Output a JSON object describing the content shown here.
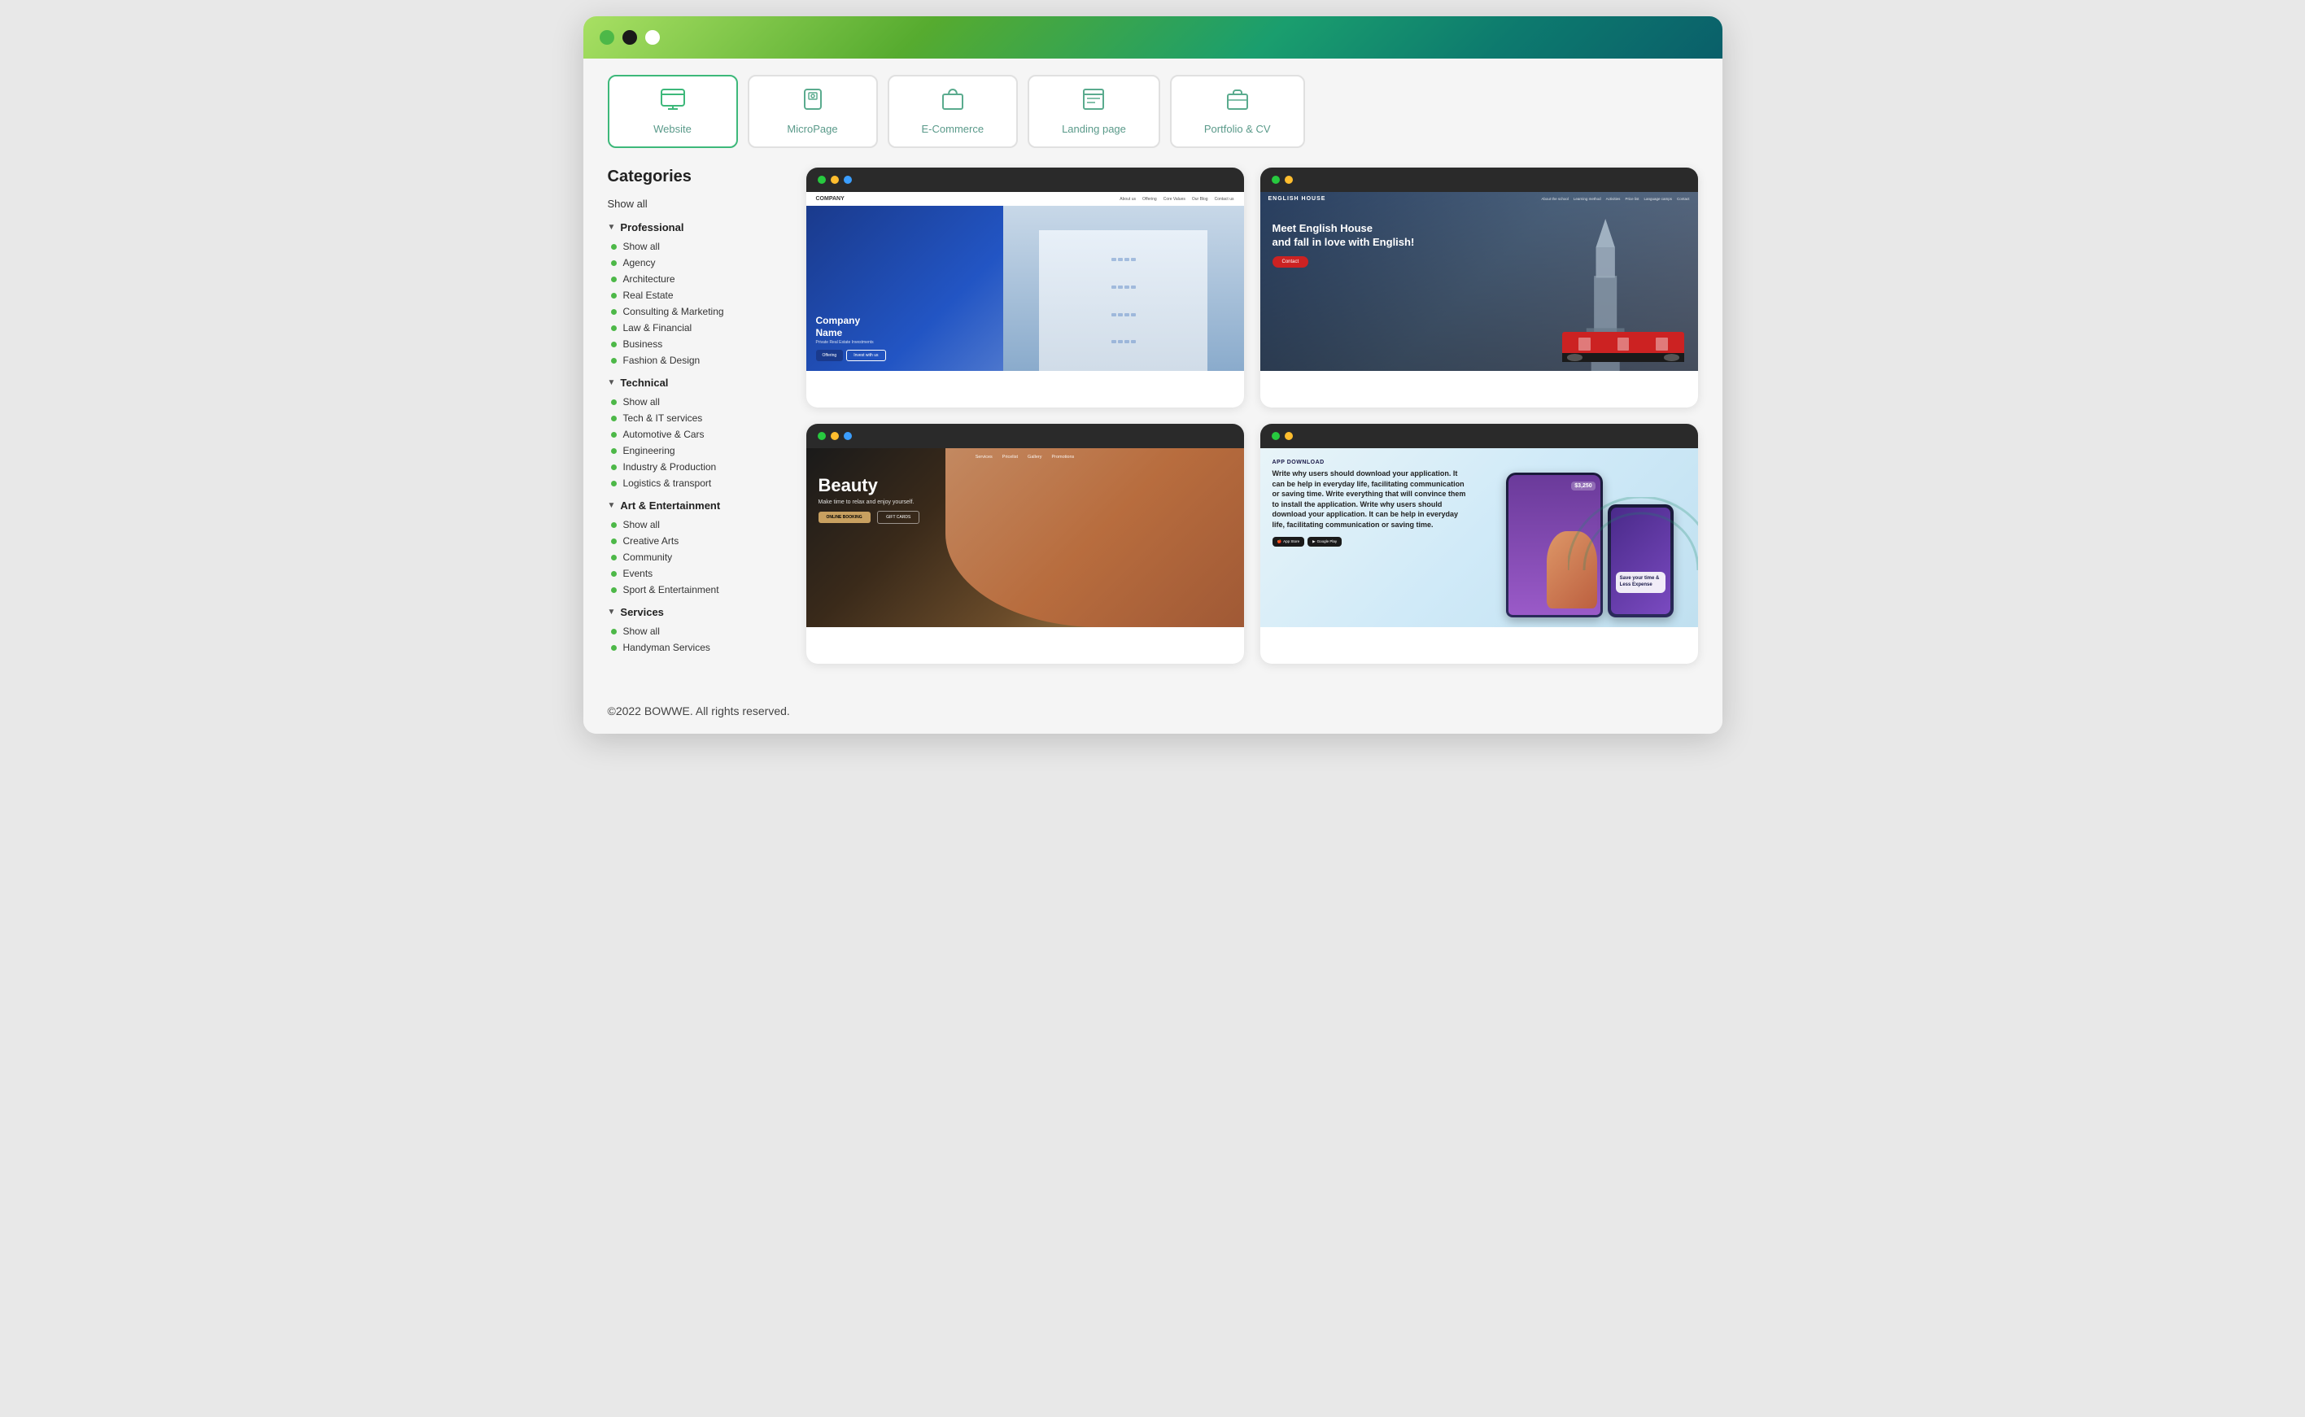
{
  "window": {
    "dots": [
      "green",
      "black",
      "white"
    ]
  },
  "tabs": [
    {
      "id": "website",
      "label": "Website",
      "icon": "🖥",
      "active": true
    },
    {
      "id": "micropage",
      "label": "MicroPage",
      "icon": "📱",
      "active": false
    },
    {
      "id": "ecommerce",
      "label": "E-Commerce",
      "icon": "🛒",
      "active": false
    },
    {
      "id": "landing",
      "label": "Landing page",
      "icon": "📄",
      "active": false
    },
    {
      "id": "portfolio",
      "label": "Portfolio & CV",
      "icon": "💼",
      "active": false
    }
  ],
  "sidebar": {
    "title": "Categories",
    "show_all": "Show all",
    "sections": [
      {
        "id": "professional",
        "label": "Professional",
        "expanded": true,
        "items": [
          {
            "label": "Show all"
          },
          {
            "label": "Agency"
          },
          {
            "label": "Architecture"
          },
          {
            "label": "Real Estate"
          },
          {
            "label": "Consulting & Marketing"
          },
          {
            "label": "Law & Financial"
          },
          {
            "label": "Business"
          },
          {
            "label": "Fashion & Design"
          }
        ]
      },
      {
        "id": "technical",
        "label": "Technical",
        "expanded": true,
        "items": [
          {
            "label": "Show all"
          },
          {
            "label": "Tech & IT services"
          },
          {
            "label": "Automotive & Cars"
          },
          {
            "label": "Engineering"
          },
          {
            "label": "Industry & Production"
          },
          {
            "label": "Logistics & transport"
          }
        ]
      },
      {
        "id": "art-entertainment",
        "label": "Art & Entertainment",
        "expanded": true,
        "items": [
          {
            "label": "Show all"
          },
          {
            "label": "Creative Arts"
          },
          {
            "label": "Community"
          },
          {
            "label": "Events"
          },
          {
            "label": "Sport & Entertainment"
          }
        ]
      },
      {
        "id": "services",
        "label": "Services",
        "expanded": true,
        "items": [
          {
            "label": "Show all"
          },
          {
            "label": "Handyman Services"
          }
        ]
      }
    ]
  },
  "templates": [
    {
      "id": "real-estate",
      "dots": [
        "green",
        "yellow",
        "blue"
      ],
      "preview_type": "real-estate",
      "nav_logo": "COMPANY",
      "nav_links": [
        "About us",
        "Offering",
        "Core Values",
        "Our Blog",
        "Contact us"
      ],
      "hero_title": "Company Name",
      "hero_subtitle": "Private Real Estate Investments",
      "btn1": "Offering",
      "btn2": "Invest with us"
    },
    {
      "id": "english-house",
      "dots": [
        "green",
        "yellow"
      ],
      "preview_type": "english",
      "nav_logo": "ENGLISH HOUSE",
      "nav_links": [
        "About the school",
        "Learning method",
        "Activities",
        "Price list",
        "Language camps",
        "Contact"
      ],
      "hero_title": "Meet English House and fall in love with English!",
      "btn": "Contact"
    },
    {
      "id": "beauty",
      "dots": [
        "green",
        "yellow",
        "blue"
      ],
      "preview_type": "beauty",
      "nav_links": [
        "Services",
        "Pricelist",
        "Gallery",
        "Promotions"
      ],
      "hero_title": "Beauty",
      "hero_subtitle": "Make time to relax and enjoy yourself.",
      "btn1": "ONLINE BOOKING",
      "btn2": "GIFT CARDS"
    },
    {
      "id": "app-download",
      "dots": [
        "green",
        "yellow"
      ],
      "preview_type": "app",
      "section_label": "APP DOWNLOAD",
      "body_text": "Write why users should download your application. It can be help in everyday life, facilitating communication or saving time. Write everything that will convince them to install the application. Write why users should download your application. It can be help in everyday life, facilitating communication or saving time.",
      "btn1": "App Store",
      "btn2": "Google Play",
      "save_amount": "$3,250",
      "save_label": "Save your time & Less Expense"
    }
  ],
  "footer": {
    "text": "©2022 BOWWE. All rights reserved."
  }
}
